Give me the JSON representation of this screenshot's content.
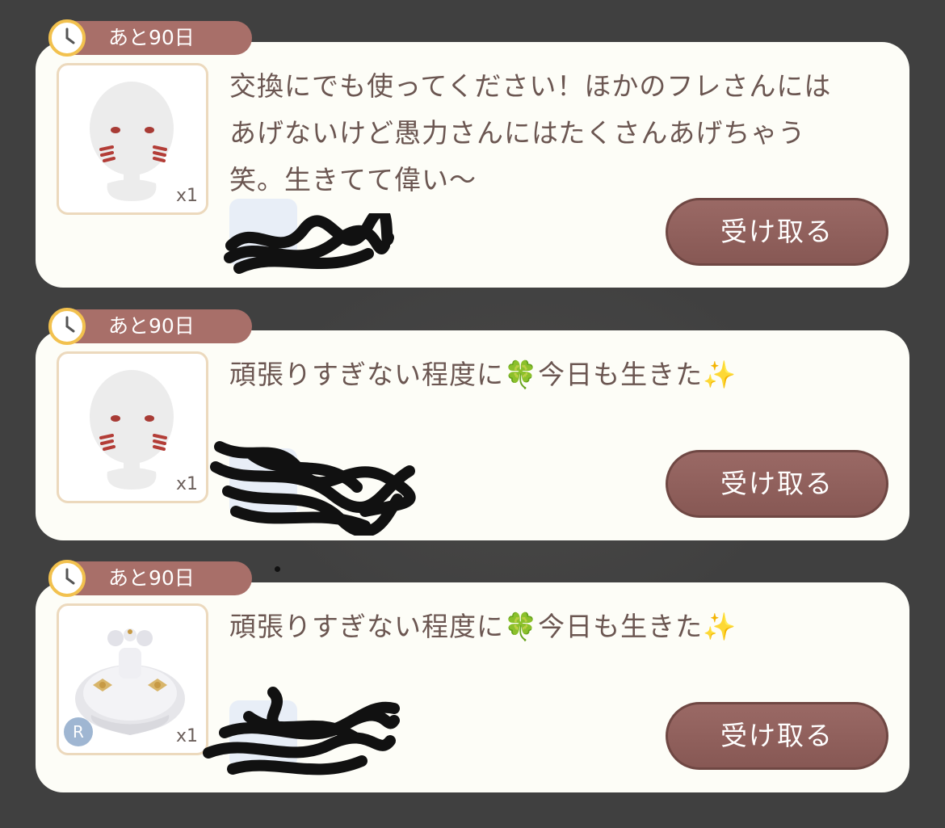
{
  "gifts": [
    {
      "timer": "あと90日",
      "message": "交換にでも使ってください！ほかのフレさんには\nあげないけど愚力さんにはたくさんあげちゃう\n笑。生きてて偉い〜",
      "quantity": "x1",
      "item_icon": "face-makeup-blush",
      "button": "受け取る"
    },
    {
      "timer": "あと90日",
      "message": "頑張りすぎない程度に🍀今日も生きた✨",
      "quantity": "x1",
      "item_icon": "face-makeup-blush",
      "button": "受け取る"
    },
    {
      "timer": "あと90日",
      "message": "頑張りすぎない程度に🍀今日も生きた✨",
      "quantity": "x1",
      "rarity": "R",
      "item_icon": "white-dress",
      "button": "受け取る"
    }
  ],
  "colors": {
    "card": "#fdfdf7",
    "timer_pill": "#a86f69",
    "button": "#8d5e5a",
    "text": "#6b5651",
    "background": "#404040"
  }
}
